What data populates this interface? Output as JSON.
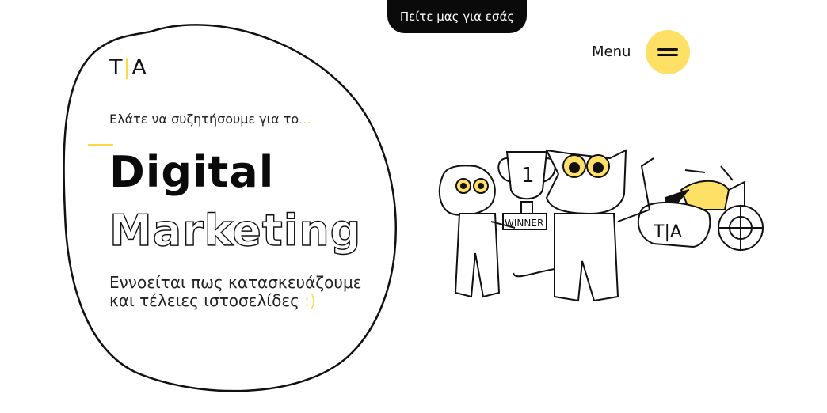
{
  "header": {
    "tell_us_label": "Πείτε μας για εσάς",
    "menu_label": "Menu"
  },
  "logo": {
    "left": "T",
    "bar": "|",
    "right": "A"
  },
  "hero": {
    "tagline": "Ελάτε να συζητήσουμε για το",
    "tagline_dots": "...",
    "title_line1": "Digital",
    "title_line2": "Marketing",
    "desc_line1": "Εννοείται πως κατασκευάζουμε",
    "desc_line2": "και τέλειες ιστοσελίδες",
    "desc_smile": ":)"
  },
  "illustration": {
    "trophy_number": "1",
    "trophy_label": "WINNER",
    "sidecar_logo": "T|A"
  },
  "colors": {
    "accent": "#ffd84a",
    "menu_button": "#ffe066",
    "dark": "#0a0a0a"
  }
}
